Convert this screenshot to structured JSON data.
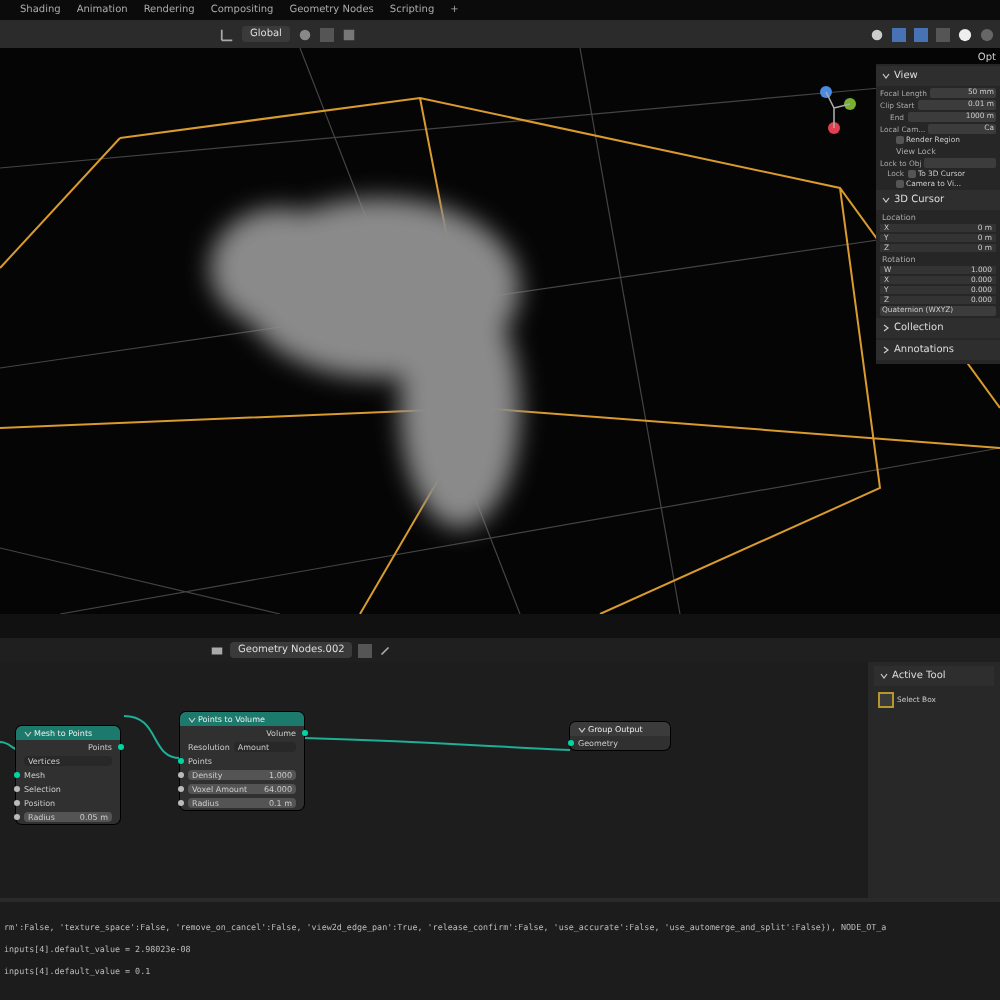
{
  "workspace_tabs": [
    {
      "label": "Shading",
      "selected": false
    },
    {
      "label": "Animation",
      "selected": false
    },
    {
      "label": "Rendering",
      "selected": false
    },
    {
      "label": "Compositing",
      "selected": false
    },
    {
      "label": "Geometry Nodes",
      "selected": false
    },
    {
      "label": "Scripting",
      "selected": false
    }
  ],
  "add_tab": "+",
  "viewport_header": {
    "orientation": "Global",
    "options": "Opt"
  },
  "sidebar": [
    {
      "kind": "section",
      "label": "View"
    },
    {
      "kind": "field",
      "label": "Focal Length",
      "value": "50 mm"
    },
    {
      "kind": "field",
      "label": "Clip Start",
      "value": "0.01 m"
    },
    {
      "kind": "field",
      "label": "End",
      "value": "1000 m"
    },
    {
      "kind": "field",
      "label": "Local Cam...",
      "value": "Ca"
    },
    {
      "kind": "check",
      "label": "Render Region",
      "checked": false
    },
    {
      "kind": "subsection",
      "label": "View Lock"
    },
    {
      "kind": "field",
      "label": "Lock to Obj"
    },
    {
      "kind": "check",
      "label": "To 3D Cursor",
      "checked": false,
      "prefix": "Lock"
    },
    {
      "kind": "check",
      "label": "Camera to Vi...",
      "checked": false
    },
    {
      "kind": "section",
      "label": "3D Cursor"
    },
    {
      "kind": "caption",
      "label": "Location"
    },
    {
      "kind": "vec",
      "label": "X",
      "value": "0 m"
    },
    {
      "kind": "vec",
      "label": "Y",
      "value": "0 m"
    },
    {
      "kind": "vec",
      "label": "Z",
      "value": "0 m"
    },
    {
      "kind": "caption",
      "label": "Rotation"
    },
    {
      "kind": "vec",
      "label": "W",
      "value": "1.000"
    },
    {
      "kind": "vec",
      "label": "X",
      "value": "0.000"
    },
    {
      "kind": "vec",
      "label": "Y",
      "value": "0.000"
    },
    {
      "kind": "vec",
      "label": "Z",
      "value": "0.000"
    },
    {
      "kind": "dropdown",
      "label": "Quaternion (WXYZ)"
    },
    {
      "kind": "section",
      "label": "Collection",
      "expanded": false
    },
    {
      "kind": "section",
      "label": "Annotations",
      "expanded": false
    }
  ],
  "node_editor": {
    "node_tree": "Geometry Nodes.002",
    "nodes": [
      {
        "title": "Mesh to Points",
        "rows": [
          {
            "kind": "output",
            "label": "Points"
          },
          {
            "kind": "dropdown",
            "label": "Vertices"
          },
          {
            "kind": "input",
            "label": "Mesh",
            "linked": true
          },
          {
            "kind": "input",
            "label": "Selection",
            "linked": false
          },
          {
            "kind": "input",
            "label": "Position",
            "linked": false
          },
          {
            "kind": "value",
            "label": "Radius",
            "value": "0.05 m"
          }
        ]
      },
      {
        "title": "Points to Volume",
        "rows": [
          {
            "kind": "output",
            "label": "Volume"
          },
          {
            "kind": "enum",
            "label": "Resolution",
            "value": "Amount"
          },
          {
            "kind": "input",
            "label": "Points",
            "linked": true
          },
          {
            "kind": "value",
            "label": "Density",
            "value": "1.000"
          },
          {
            "kind": "value",
            "label": "Voxel Amount",
            "value": "64.000"
          },
          {
            "kind": "value",
            "label": "Radius",
            "value": "0.1 m"
          }
        ]
      },
      {
        "title": "Group Output",
        "rows": [
          {
            "kind": "input",
            "label": "Geometry",
            "linked": true
          }
        ]
      }
    ],
    "tool_panel": {
      "title": "Active Tool",
      "tool": "Select Box"
    }
  },
  "console": [
    "rm':False, 'texture_space':False, 'remove_on_cancel':False, 'view2d_edge_pan':True, 'release_confirm':False, 'use_accurate':False, 'use_automerge_and_split':False}), NODE_OT_a",
    "inputs[4].default_value = 2.98023e-08",
    "inputs[4].default_value = 0.1"
  ]
}
